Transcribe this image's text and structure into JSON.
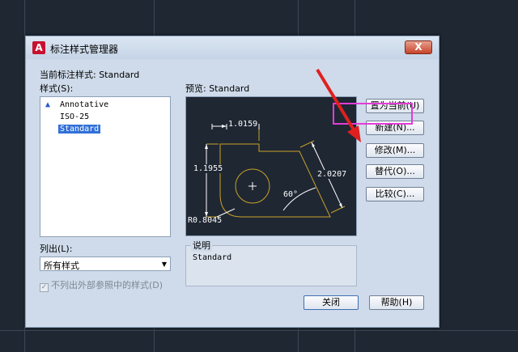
{
  "window": {
    "title": "标注样式管理器",
    "close_label": "X"
  },
  "current_style_label": "当前标注样式: Standard",
  "styles_label": "样式(S):",
  "styles": [
    {
      "label": "Annotative",
      "annotative": true
    },
    {
      "label": "ISO-25",
      "annotative": false
    },
    {
      "label": "Standard",
      "annotative": false,
      "selected": true
    }
  ],
  "preview_label": "预览: Standard",
  "preview": {
    "dim_top": "1.0159",
    "dim_left": "1.1955",
    "dim_right": "2.0207",
    "angle": "60°",
    "radius": "R0.8045",
    "accent": "#c8a12a"
  },
  "buttons": {
    "set_current": "置为当前(U)",
    "new": "新建(N)...",
    "modify": "修改(M)...",
    "override": "替代(O)...",
    "compare": "比较(C)...",
    "close": "关闭",
    "help": "帮助(H)"
  },
  "list_label": "列出(L):",
  "list_value": "所有样式",
  "checkbox_label": "不列出外部参照中的样式(D)",
  "description_legend": "说明",
  "description_text": "Standard",
  "annotation_color": "#e33cd8"
}
